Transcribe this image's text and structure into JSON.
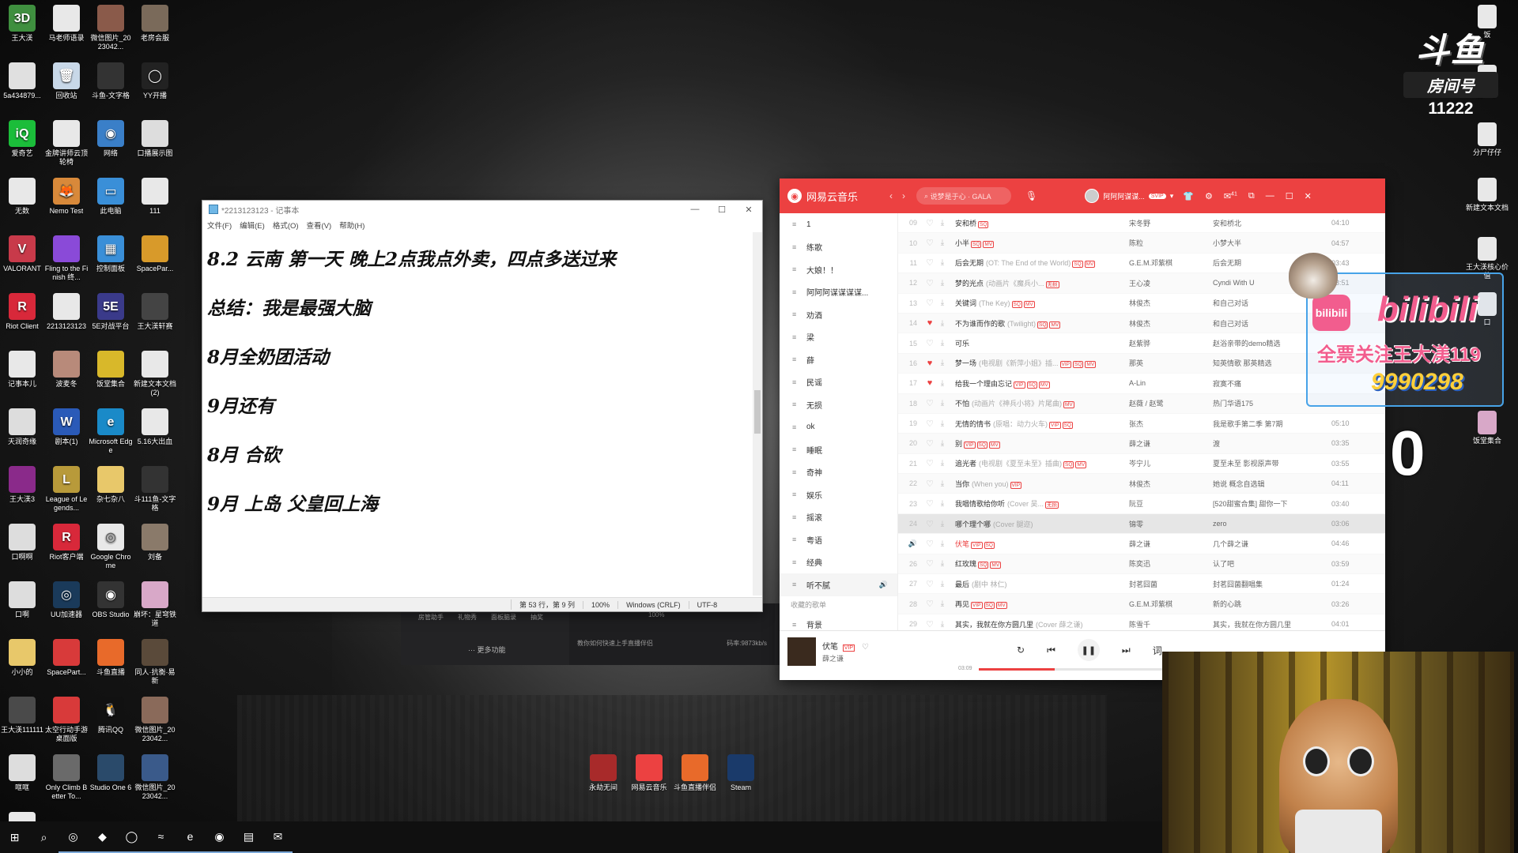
{
  "desktop": {
    "left_icons": [
      {
        "label": "王大渼",
        "color": "#3f8f3f",
        "glyph": "3D"
      },
      {
        "label": "马老师语录",
        "color": "#e8e8e8",
        "glyph": ""
      },
      {
        "label": "微信图片_2023042...",
        "color": "#8a5a4a",
        "glyph": ""
      },
      {
        "label": "老房会服",
        "color": "#7a6a5a",
        "glyph": ""
      },
      {
        "label": "5a434879...",
        "color": "#e0e0e0",
        "glyph": ""
      },
      {
        "label": "回收站",
        "color": "#c8d8e8",
        "glyph": "🗑"
      },
      {
        "label": "斗鱼-文字格",
        "color": "#333",
        "glyph": ""
      },
      {
        "label": "YY开播",
        "color": "#222",
        "glyph": "◯"
      },
      {
        "label": "爱奇艺",
        "color": "#1bbd3a",
        "glyph": "iQ"
      },
      {
        "label": "金牌讲师云顶轮椅",
        "color": "#e8e8e8",
        "glyph": ""
      },
      {
        "label": "网络",
        "color": "#3a7fc8",
        "glyph": "◉"
      },
      {
        "label": "口播展示图",
        "color": "#ddd",
        "glyph": ""
      },
      {
        "label": "无数",
        "color": "#e8e8e8",
        "glyph": ""
      },
      {
        "label": "Nemo Test",
        "color": "#d8893a",
        "glyph": "🦊"
      },
      {
        "label": "此电脑",
        "color": "#3a8fd8",
        "glyph": "▭"
      },
      {
        "label": "111",
        "color": "#e8e8e8",
        "glyph": ""
      },
      {
        "label": "VALORANT",
        "color": "#c83a4a",
        "glyph": "V"
      },
      {
        "label": "Fling to the Finish 终...",
        "color": "#8a4ad8",
        "glyph": ""
      },
      {
        "label": "控制面板",
        "color": "#3a8fd8",
        "glyph": "▦"
      },
      {
        "label": "SpacePar...",
        "color": "#d89a2a",
        "glyph": ""
      },
      {
        "label": "Riot Client",
        "color": "#d8283a",
        "glyph": "R"
      },
      {
        "label": "2213123123",
        "color": "#e8e8e8",
        "glyph": ""
      },
      {
        "label": "5E对战平台",
        "color": "#3a3a8a",
        "glyph": "5E"
      },
      {
        "label": "王大渼轩赛",
        "color": "#444",
        "glyph": ""
      },
      {
        "label": "记事本儿",
        "color": "#e8e8e8",
        "glyph": ""
      },
      {
        "label": "波麦冬",
        "color": "#b88a7a",
        "glyph": ""
      },
      {
        "label": "饭堂集合",
        "color": "#d8b82a",
        "glyph": ""
      },
      {
        "label": "新建文本文档 (2)",
        "color": "#e8e8e8",
        "glyph": ""
      },
      {
        "label": "天润奇缘",
        "color": "#ddd",
        "glyph": ""
      },
      {
        "label": "剧本(1)",
        "color": "#2a5ab8",
        "glyph": "W"
      },
      {
        "label": "Microsoft Edge",
        "color": "#1a8ac8",
        "glyph": "e"
      },
      {
        "label": "5.16大出血",
        "color": "#e8e8e8",
        "glyph": ""
      },
      {
        "label": "王大渼3",
        "color": "#8a2a8a",
        "glyph": ""
      },
      {
        "label": "League of Legends...",
        "color": "#b89a3a",
        "glyph": "L"
      },
      {
        "label": "杂七杂八",
        "color": "#e8c86a",
        "glyph": ""
      },
      {
        "label": "斗111鱼-文字格",
        "color": "#333",
        "glyph": ""
      },
      {
        "label": "口啊啊",
        "color": "#ddd",
        "glyph": ""
      },
      {
        "label": "Riot客户端",
        "color": "#d8283a",
        "glyph": "R"
      },
      {
        "label": "Google Chrome",
        "color": "#e8e8e8",
        "glyph": "◎"
      },
      {
        "label": "刘备",
        "color": "#8a7a6a",
        "glyph": ""
      },
      {
        "label": "口啊",
        "color": "#ddd",
        "glyph": ""
      },
      {
        "label": "UU加速器",
        "color": "#1a3a5a",
        "glyph": "◎"
      },
      {
        "label": "OBS Studio",
        "color": "#333",
        "glyph": "◉"
      },
      {
        "label": "崩坏：星穹铁道",
        "color": "#d8a8c8",
        "glyph": ""
      },
      {
        "label": "小小的",
        "color": "#e8c86a",
        "glyph": ""
      },
      {
        "label": "SpacePart...",
        "color": "#d83a3a",
        "glyph": ""
      },
      {
        "label": "斗鱼直播",
        "color": "#e86a2a",
        "glyph": ""
      },
      {
        "label": "同人·抗衡·易新",
        "color": "#5a4a3a",
        "glyph": ""
      },
      {
        "label": "王大渼111111",
        "color": "#4a4a4a",
        "glyph": ""
      },
      {
        "label": "太空行动手游桌面版",
        "color": "#d83a3a",
        "glyph": ""
      },
      {
        "label": "腾讯QQ",
        "color": "#111",
        "glyph": "🐧"
      },
      {
        "label": "微信图片_2023042...",
        "color": "#8a6a5a",
        "glyph": ""
      },
      {
        "label": "哐哐",
        "color": "#ddd",
        "glyph": ""
      },
      {
        "label": "Only Climb Better To...",
        "color": "#6a6a6a",
        "glyph": ""
      },
      {
        "label": "Studio One 6",
        "color": "#2a4a6a",
        "glyph": ""
      },
      {
        "label": "微信图片_2023042...",
        "color": "#3a5a8a",
        "glyph": ""
      },
      {
        "label": "新建文本文档 (3)",
        "color": "#e8e8e8",
        "glyph": ""
      }
    ],
    "right_icons": [
      {
        "label": "饭",
        "color": "#e8e8e8"
      },
      {
        "label": "口一下",
        "color": "#e8e8e8"
      },
      {
        "label": "分尸仔仔",
        "color": "#e8e8e8"
      },
      {
        "label": "新建文本文档",
        "color": "#e8e8e8"
      },
      {
        "label": "王大渼核心价值",
        "color": "#e8e8e8"
      },
      {
        "label": "口",
        "color": "#e8e8e8"
      },
      {
        "label": "饭堂集合",
        "color": "#d8a8c8"
      }
    ],
    "center_icons": [
      {
        "label": "永劫无间",
        "color": "#a82a2a"
      },
      {
        "label": "网易云音乐",
        "color": "#ec4141"
      },
      {
        "label": "斗鱼直播伴侣",
        "color": "#e86a2a"
      },
      {
        "label": "Steam",
        "color": "#1a3a6a"
      }
    ]
  },
  "notepad": {
    "title": "*2213123123 - 记事本",
    "menu": [
      "文件(F)",
      "编辑(E)",
      "格式(O)",
      "查看(V)",
      "帮助(H)"
    ],
    "lines": [
      "8.2  云南 第一天 晚上2点我点外卖，四点多送过来",
      "总结：我是最强大脑",
      "8月全奶团活动",
      "9月还有",
      "8月 合砍",
      "9月 上岛 父皇回上海"
    ],
    "status": {
      "position": "第 53 行，第 9 列",
      "zoom": "100%",
      "eol": "Windows (CRLF)",
      "encoding": "UTF-8"
    }
  },
  "obs": {
    "buttons": [
      "房管助手",
      "礼物秀",
      "面板脑录",
      "抽奖"
    ],
    "more": "··· 更多功能",
    "zoom": "100%",
    "hint": "教你如何快速上手直播伴侣",
    "bitrate": "码率:9873kb/s"
  },
  "music": {
    "app_name": "网易云音乐",
    "search_placeholder": "说梦是于心 · GALA",
    "user_name": "阿阿阿谋谋...",
    "vip_badge": "SVIP",
    "msg_count": "41",
    "sidebar": [
      "1",
      "练歌",
      "大娘！！",
      "阿阿阿谋谋谋谋...",
      "劝酒",
      "梁",
      "薛",
      "民谣",
      "无损",
      "ok",
      "睡眠",
      "奇神",
      "娱乐",
      "摇滚",
      "粤语",
      "经典",
      "听不腻"
    ],
    "sidebar_section": "收藏的歌单",
    "sidebar_after": [
      "背景"
    ],
    "songs": [
      {
        "idx": "09",
        "title": "安和桥",
        "sub": "",
        "tags": [
          "SQ"
        ],
        "liked": false,
        "artist": "宋冬野",
        "album": "安和桥北",
        "dur": "04:10"
      },
      {
        "idx": "10",
        "title": "小半",
        "sub": "",
        "tags": [
          "SQ",
          "MV"
        ],
        "liked": false,
        "artist": "陈粒",
        "album": "小梦大半",
        "dur": "04:57"
      },
      {
        "idx": "11",
        "title": "后会无期",
        "sub": "(OT: The End of the World)",
        "tags": [
          "SQ",
          "MV"
        ],
        "liked": false,
        "artist": "G.E.M.邓紫棋",
        "album": "后会无期",
        "dur": "03:43"
      },
      {
        "idx": "12",
        "title": "梦的光点",
        "sub": "(动画片《魔兵小...",
        "tags": [
          "无损"
        ],
        "liked": false,
        "artist": "王心凌",
        "album": "Cyndi With U",
        "dur": "03:51"
      },
      {
        "idx": "13",
        "title": "关键词",
        "sub": "(The Key)",
        "tags": [
          "SQ",
          "MV"
        ],
        "liked": false,
        "artist": "林俊杰",
        "album": "和自己对话",
        "dur": ""
      },
      {
        "idx": "14",
        "title": "不为谁而作的歌",
        "sub": "(Twilight)",
        "tags": [
          "SQ",
          "MV"
        ],
        "liked": true,
        "artist": "林俊杰",
        "album": "和自己对话",
        "dur": ""
      },
      {
        "idx": "15",
        "title": "可乐",
        "sub": "",
        "tags": [],
        "liked": false,
        "artist": "赵紫骅",
        "album": "赵浴亲带的demo精选",
        "dur": ""
      },
      {
        "idx": "16",
        "title": "梦一场",
        "sub": "(电视剧《新萍小姐》插...",
        "tags": [
          "VIP",
          "SQ",
          "MV"
        ],
        "liked": true,
        "artist": "那英",
        "album": "知英情歌 那英精选",
        "dur": ""
      },
      {
        "idx": "17",
        "title": "给我一个理由忘记",
        "sub": "",
        "tags": [
          "VIP",
          "SQ",
          "MV"
        ],
        "liked": true,
        "artist": "A-Lin",
        "album": "寂寞不痛",
        "dur": ""
      },
      {
        "idx": "18",
        "title": "不怕",
        "sub": "(动画片《神兵小将》片尾曲)",
        "tags": [
          "MV"
        ],
        "liked": false,
        "artist": "赵薇 / 赵鹭",
        "album": "热门华语175",
        "dur": ""
      },
      {
        "idx": "19",
        "title": "无情的情书",
        "sub": "(原唱：动力火车)",
        "tags": [
          "VIP",
          "SQ"
        ],
        "liked": false,
        "artist": "张杰",
        "album": "我是歌手第二季 第7期",
        "dur": "05:10"
      },
      {
        "idx": "20",
        "title": "别",
        "sub": "",
        "tags": [
          "VIP",
          "SQ",
          "MV"
        ],
        "liked": false,
        "artist": "薛之谦",
        "album": "渡",
        "dur": "03:35"
      },
      {
        "idx": "21",
        "title": "追光者",
        "sub": "(电视剧《夏至未至》插曲)",
        "tags": [
          "SQ",
          "MV"
        ],
        "liked": false,
        "artist": "岑宁儿",
        "album": "夏至未至 影视原声带",
        "dur": "03:55"
      },
      {
        "idx": "22",
        "title": "当你",
        "sub": "(When you)",
        "tags": [
          "VIP"
        ],
        "liked": false,
        "artist": "林俊杰",
        "album": "她说 概念自选辑",
        "dur": "04:11"
      },
      {
        "idx": "23",
        "title": "我唱情歌给你听",
        "sub": "(Cover 吴...",
        "tags": [
          "无损"
        ],
        "liked": false,
        "artist": "阮豆",
        "album": "[520甜蜜合集] 甜你一下",
        "dur": "03:40"
      },
      {
        "idx": "24",
        "title": "哪个理个哪",
        "sub": "(Cover 腿迩)",
        "tags": [],
        "liked": false,
        "artist": "锦零",
        "album": "zero",
        "dur": "03:06"
      },
      {
        "idx": "25",
        "title": "伏笔",
        "sub": "",
        "tags": [
          "VIP",
          "SQ"
        ],
        "liked": false,
        "artist": "薛之谦",
        "album": "几个薛之谦",
        "dur": "04:46"
      },
      {
        "idx": "26",
        "title": "红玫瑰",
        "sub": "",
        "tags": [
          "SQ",
          "MV"
        ],
        "liked": false,
        "artist": "陈奕迅",
        "album": "认了吧",
        "dur": "03:59"
      },
      {
        "idx": "27",
        "title": "最后",
        "sub": "(剧中 林仁)",
        "tags": [],
        "liked": false,
        "artist": "封茗囧菌",
        "album": "封茗囧菌翻唱集",
        "dur": "01:24"
      },
      {
        "idx": "28",
        "title": "再见",
        "sub": "",
        "tags": [
          "VIP",
          "SQ",
          "MV"
        ],
        "liked": false,
        "artist": "G.E.M.邓紫棋",
        "album": "新的心跳",
        "dur": "03:26"
      },
      {
        "idx": "29",
        "title": "其实，我就在你方圆几里",
        "sub": "(Cover 薛之谦)",
        "tags": [],
        "liked": false,
        "artist": "陈雪千",
        "album": "其实，我就在你方圆几里",
        "dur": "04:01"
      }
    ],
    "now_playing": {
      "title": "伏笔",
      "tag": "VIP",
      "artist": "薛之谦",
      "time": "03:09",
      "progress": 0.4
    },
    "playing_index": 16,
    "selected_index": 15
  },
  "douyu": {
    "logo": "斗鱼",
    "room_label": "房间号",
    "room_number": "11222"
  },
  "bilibili": {
    "logo": "bilibili",
    "wordmark": "bilibili",
    "fans_text": "全票关注王大渼119",
    "count": "9990298"
  },
  "counter": "0",
  "taskbar": [
    {
      "name": "start",
      "glyph": "⊞"
    },
    {
      "name": "search",
      "glyph": "⌕"
    },
    {
      "name": "chrome",
      "glyph": "◎"
    },
    {
      "name": "app1",
      "glyph": "◆"
    },
    {
      "name": "yy",
      "glyph": "◯"
    },
    {
      "name": "app2",
      "glyph": "≈"
    },
    {
      "name": "edge",
      "glyph": "e"
    },
    {
      "name": "netease",
      "glyph": "◉"
    },
    {
      "name": "notepad",
      "glyph": "▤"
    },
    {
      "name": "wechat",
      "glyph": "✉"
    }
  ],
  "colors": {
    "netease_red": "#ec4141",
    "bili_pink": "#f25d8e"
  }
}
